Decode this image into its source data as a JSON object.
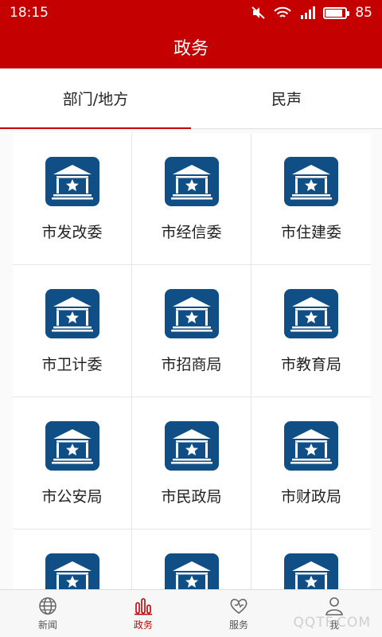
{
  "status_bar": {
    "time": "18:15",
    "battery": "85",
    "battery_level": 0.85
  },
  "header": {
    "title": "政务"
  },
  "tabs": [
    {
      "label": "部门/地方",
      "active": true
    },
    {
      "label": "民声",
      "active": false
    }
  ],
  "departments": [
    {
      "label": "市发改委"
    },
    {
      "label": "市经信委"
    },
    {
      "label": "市住建委"
    },
    {
      "label": "市卫计委"
    },
    {
      "label": "市招商局"
    },
    {
      "label": "市教育局"
    },
    {
      "label": "市公安局"
    },
    {
      "label": "市民政局"
    },
    {
      "label": "市财政局"
    },
    {
      "label": ""
    },
    {
      "label": ""
    },
    {
      "label": ""
    }
  ],
  "bottom_nav": [
    {
      "label": "新闻",
      "icon": "globe-icon",
      "active": false
    },
    {
      "label": "政务",
      "icon": "bar-chart-icon",
      "active": true
    },
    {
      "label": "服务",
      "icon": "heart-icon",
      "active": false
    },
    {
      "label": "我",
      "icon": "user-icon",
      "active": false
    }
  ],
  "colors": {
    "brand": "#c40000",
    "icon_bg": "#0f4f85"
  },
  "watermark": "QQTF.COM"
}
